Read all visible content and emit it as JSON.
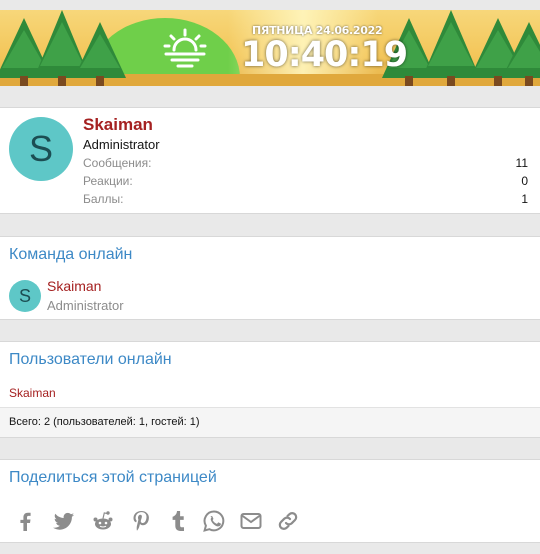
{
  "clock": {
    "date": "ПЯТНИЦА 24.06.2022",
    "time": "10:40:19"
  },
  "profile": {
    "avatar_letter": "S",
    "username": "Skaiman",
    "title": "Administrator",
    "stats": [
      {
        "label": "Сообщения:",
        "value": "11"
      },
      {
        "label": "Реакции:",
        "value": "0"
      },
      {
        "label": "Баллы:",
        "value": "1"
      }
    ]
  },
  "team_online": {
    "heading": "Команда онлайн",
    "member": {
      "avatar_letter": "S",
      "name": "Skaiman",
      "title": "Administrator"
    }
  },
  "users_online": {
    "heading": "Пользователи онлайн",
    "users": [
      "Skaiman"
    ],
    "footer": "Всего: 2 (пользователей: 1, гостей: 1)"
  },
  "share": {
    "heading": "Поделиться этой страницей",
    "icons": [
      "facebook-icon",
      "twitter-icon",
      "reddit-icon",
      "pinterest-icon",
      "tumblr-icon",
      "whatsapp-icon",
      "email-icon",
      "link-icon"
    ]
  },
  "colors": {
    "username": "#a52121",
    "heading": "#3d89c6",
    "avatar": "#5ec7c7",
    "icon": "#8c8c8c"
  }
}
